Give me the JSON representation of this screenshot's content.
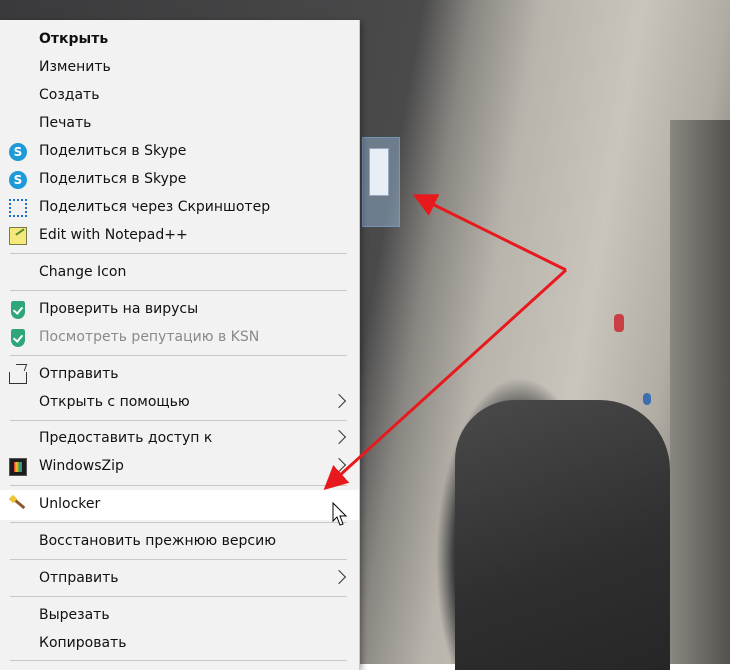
{
  "menu": {
    "items": [
      {
        "label": "Открыть",
        "icon": ""
      },
      {
        "label": "Изменить",
        "icon": ""
      },
      {
        "label": "Создать",
        "icon": ""
      },
      {
        "label": "Печать",
        "icon": ""
      },
      {
        "label": "Поделиться в Skype",
        "icon": "skype-icon"
      },
      {
        "label": "Поделиться в Skype",
        "icon": "skype-icon"
      },
      {
        "label": "Поделиться через Скриншотер",
        "icon": "screenshot-icon"
      },
      {
        "label": "Edit with Notepad++",
        "icon": "notepad-plus-plus-icon"
      },
      {
        "label": "Change Icon",
        "icon": ""
      },
      {
        "label": "Проверить на вирусы",
        "icon": "kaspersky-shield-icon"
      },
      {
        "label": "Посмотреть репутацию в KSN",
        "icon": "kaspersky-shield-icon"
      },
      {
        "label": "Отправить",
        "icon": "share-icon"
      },
      {
        "label": "Открыть с помощью",
        "icon": ""
      },
      {
        "label": "Предоставить доступ к",
        "icon": ""
      },
      {
        "label": "WindowsZip",
        "icon": "windowszip-icon"
      },
      {
        "label": "Unlocker",
        "icon": "magic-wand-icon"
      },
      {
        "label": "Восстановить прежнюю версию",
        "icon": ""
      },
      {
        "label": "Отправить",
        "icon": ""
      },
      {
        "label": "Вырезать",
        "icon": ""
      },
      {
        "label": "Копировать",
        "icon": ""
      }
    ],
    "skype_glyph": "S",
    "hovered_item": "Unlocker",
    "disabled_item": "Посмотреть репутацию в KSN"
  },
  "colors": {
    "menu_background": "#f2f2f2",
    "hover_background": "#ffffff",
    "annotation_arrow": "#e8191c",
    "skype_blue": "#1e9bd7",
    "kaspersky_green": "#2fa67a"
  }
}
